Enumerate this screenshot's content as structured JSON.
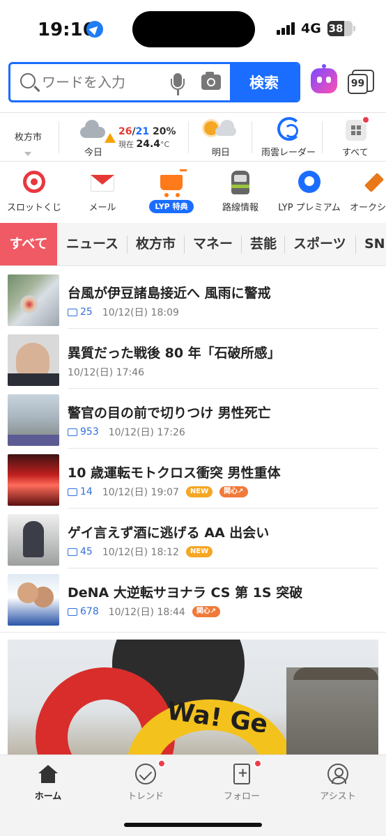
{
  "status_bar": {
    "time": "19:16",
    "network": "4G",
    "battery": "38"
  },
  "search": {
    "placeholder": "ワードを入力",
    "button_label": "検索",
    "tabs_count": "99"
  },
  "weather": {
    "location": "枚方市",
    "today_label": "今日",
    "high": "26",
    "low": "21",
    "rain_chance": "20%",
    "current_label": "現在",
    "current_temp": "24.4",
    "unit": "°C",
    "tomorrow_label": "明日",
    "radar_label": "雨雲レーダー",
    "all_label": "すべて"
  },
  "services": [
    {
      "label": "スロットくじ",
      "icon": "target-icon"
    },
    {
      "label": "メール",
      "icon": "mail-icon"
    },
    {
      "label": "",
      "icon": "cart-icon",
      "badge": "LYP 特典"
    },
    {
      "label": "路線情報",
      "icon": "train-icon"
    },
    {
      "label": "LYP プレミアム",
      "icon": "lyp-premium-icon"
    },
    {
      "label": "オークシ",
      "icon": "auction-hammer-icon"
    }
  ],
  "categories": [
    "すべて",
    "ニュース",
    "枚方市",
    "マネー",
    "芸能",
    "スポーツ",
    "SNS"
  ],
  "news": [
    {
      "title": "台風が伊豆諸島接近へ 風雨に警戒",
      "comments": "25",
      "time": "10/12(日) 18:09",
      "badges": []
    },
    {
      "title": "異質だった戦後 80 年「石破所感」",
      "comments": "",
      "time": "10/12(日) 17:46",
      "badges": []
    },
    {
      "title": "警官の目の前で切りつけ 男性死亡",
      "comments": "953",
      "time": "10/12(日) 17:26",
      "badges": []
    },
    {
      "title": "10 歳運転モトクロス衝突 男性重体",
      "comments": "14",
      "time": "10/12(日) 19:07",
      "badges": [
        "NEW",
        "関心↗"
      ]
    },
    {
      "title": "ゲイ言えず酒に逃げる AA 出会い",
      "comments": "45",
      "time": "10/12(日) 18:12",
      "badges": [
        "NEW"
      ]
    },
    {
      "title": "DeNA 大逆転サヨナラ CS 第 1S 突破",
      "comments": "678",
      "time": "10/12(日) 18:44",
      "badges": [
        "関心↗"
      ]
    }
  ],
  "hero": {
    "sign_text": "Wa! Ge"
  },
  "tabbar": [
    {
      "label": "ホーム",
      "active": true
    },
    {
      "label": "トレンド",
      "dot": true
    },
    {
      "label": "フォロー",
      "dot": true
    },
    {
      "label": "アシスト"
    }
  ],
  "colors": {
    "accent": "#1a6dff",
    "category_active": "#f05a64",
    "badge_new": "#f5a623",
    "notification": "#ec3d4a"
  }
}
